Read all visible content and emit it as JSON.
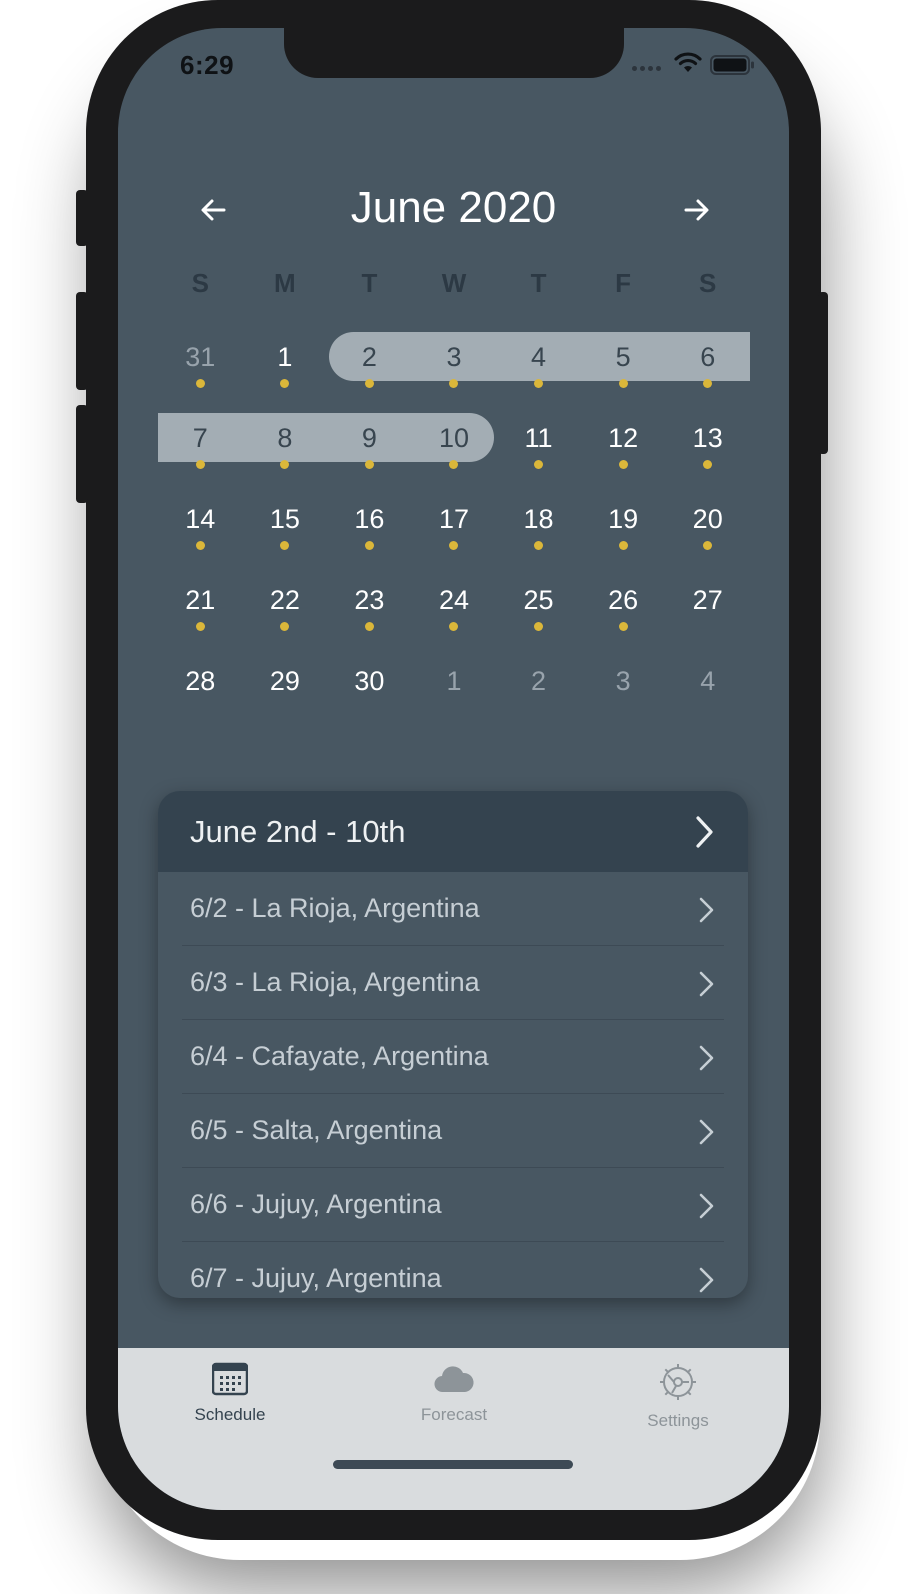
{
  "status": {
    "time": "6:29"
  },
  "calendar": {
    "month_title": "June 2020",
    "weekdays": [
      "S",
      "M",
      "T",
      "W",
      "T",
      "F",
      "S"
    ],
    "weeks": [
      [
        {
          "d": "31",
          "other": true,
          "dot": true
        },
        {
          "d": "1",
          "dot": true
        },
        {
          "d": "2",
          "dot": true,
          "sel": true
        },
        {
          "d": "3",
          "dot": true,
          "sel": true
        },
        {
          "d": "4",
          "dot": true,
          "sel": true
        },
        {
          "d": "5",
          "dot": true,
          "sel": true
        },
        {
          "d": "6",
          "dot": true,
          "sel": true
        }
      ],
      [
        {
          "d": "7",
          "dot": true,
          "sel": true
        },
        {
          "d": "8",
          "dot": true,
          "sel": true
        },
        {
          "d": "9",
          "dot": true,
          "sel": true
        },
        {
          "d": "10",
          "dot": true,
          "sel": true
        },
        {
          "d": "11",
          "dot": true
        },
        {
          "d": "12",
          "dot": true
        },
        {
          "d": "13",
          "dot": true
        }
      ],
      [
        {
          "d": "14",
          "dot": true
        },
        {
          "d": "15",
          "dot": true
        },
        {
          "d": "16",
          "dot": true
        },
        {
          "d": "17",
          "dot": true
        },
        {
          "d": "18",
          "dot": true
        },
        {
          "d": "19",
          "dot": true
        },
        {
          "d": "20",
          "dot": true
        }
      ],
      [
        {
          "d": "21",
          "dot": true
        },
        {
          "d": "22",
          "dot": true
        },
        {
          "d": "23",
          "dot": true
        },
        {
          "d": "24",
          "dot": true
        },
        {
          "d": "25",
          "dot": true
        },
        {
          "d": "26",
          "dot": true
        },
        {
          "d": "27",
          "dot": false
        }
      ],
      [
        {
          "d": "28",
          "dot": false
        },
        {
          "d": "29",
          "dot": false
        },
        {
          "d": "30",
          "dot": false
        },
        {
          "d": "1",
          "other": true,
          "dot": false
        },
        {
          "d": "2",
          "other": true,
          "dot": false
        },
        {
          "d": "3",
          "other": true,
          "dot": false
        },
        {
          "d": "4",
          "other": true,
          "dot": false
        }
      ]
    ]
  },
  "trip_card": {
    "title": "June 2nd - 10th",
    "items": [
      "6/2 - La Rioja, Argentina",
      "6/3 - La Rioja, Argentina",
      "6/4 - Cafayate, Argentina",
      "6/5 - Salta, Argentina",
      "6/6 - Jujuy, Argentina",
      "6/7 - Jujuy, Argentina"
    ]
  },
  "tabs": [
    {
      "label": "Schedule",
      "icon": "calendar-icon",
      "active": true
    },
    {
      "label": "Forecast",
      "icon": "cloud-icon",
      "active": false
    },
    {
      "label": "Settings",
      "icon": "gear-icon",
      "active": false
    }
  ],
  "colors": {
    "background": "#485762",
    "header": "#34434f",
    "range_highlight": "#a3adb4",
    "event_dot": "#dbb73a",
    "tabbar": "#d9dcde"
  }
}
